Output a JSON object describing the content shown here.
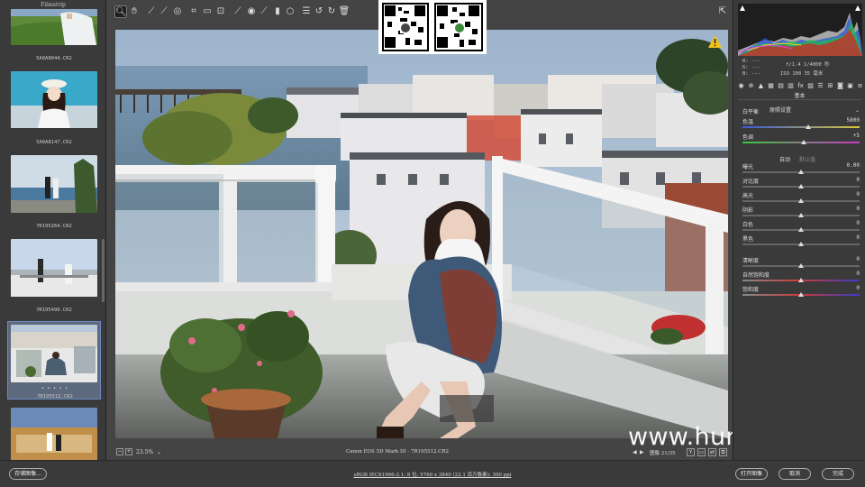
{
  "filmstrip": {
    "title": "Filmstrip",
    "items": [
      {
        "caption": "5A0A8044.CR2",
        "selected": false
      },
      {
        "caption": "5A0A8147.CR2",
        "selected": false
      },
      {
        "caption": "7R195264.CR2",
        "selected": false
      },
      {
        "caption": "7R195490.CR2",
        "selected": false
      },
      {
        "caption": "7R195512.CR2",
        "selected": true,
        "rating": "• • • • •"
      },
      {
        "caption": "",
        "selected": false
      }
    ]
  },
  "toolbar": {
    "tools": [
      "zoom-icon",
      "hand-icon",
      "white-balance-icon",
      "color-sampler-icon",
      "target-adjust-icon",
      "crop-icon",
      "straighten-icon",
      "transform-icon",
      "spot-removal-icon",
      "red-eye-icon",
      "brush-icon",
      "graduated-filter-icon",
      "radial-filter-icon",
      "preferences-icon",
      "rotate-left-icon",
      "rotate-right-icon",
      "trash-icon"
    ],
    "fullscreen": "fullscreen-icon"
  },
  "status": {
    "zoom": "23.5%",
    "camera": "Canon EOS 5D Mark III  -  7R195512.CR2",
    "counter": "图像 21/35",
    "filter_label": "Y"
  },
  "histogram": {
    "r_label": "R:",
    "g_label": "G:",
    "b_label": "B:",
    "r_value": "---",
    "g_value": "---",
    "b_value": "---",
    "exif_line1": "f/1.4  1/4000 秒",
    "exif_line2": "ISO 100  35 毫米"
  },
  "panel": {
    "title": "基本",
    "white_balance_label": "白平衡",
    "white_balance_value": "原照设置",
    "auto_label": "自动",
    "default_label": "默认值",
    "sliders": [
      {
        "name": "temperature",
        "label": "色温",
        "value": "5800",
        "level": 0.56
      },
      {
        "name": "tint",
        "label": "色调",
        "value": "+5",
        "level": 0.52
      },
      {
        "name": "exposure",
        "label": "曝光",
        "value": "0.00",
        "level": 0.5
      },
      {
        "name": "contrast",
        "label": "对比度",
        "value": "0",
        "level": 0.5
      },
      {
        "name": "highlights",
        "label": "高光",
        "value": "0",
        "level": 0.5
      },
      {
        "name": "shadows",
        "label": "阴影",
        "value": "0",
        "level": 0.5
      },
      {
        "name": "whites",
        "label": "白色",
        "value": "0",
        "level": 0.5
      },
      {
        "name": "blacks",
        "label": "黑色",
        "value": "0",
        "level": 0.5
      },
      {
        "name": "clarity",
        "label": "清晰度",
        "value": "0",
        "level": 0.5
      },
      {
        "name": "vibrance",
        "label": "自然饱和度",
        "value": "0",
        "level": 0.5
      },
      {
        "name": "saturation",
        "label": "饱和度",
        "value": "0",
        "level": 0.5
      }
    ]
  },
  "bottom": {
    "save_label": "存储图像...",
    "workflow": "sRGB IEC61966-2.1; 8 位; 5760 x 3840 (22.1 百万像素); 300 ppi",
    "open_label": "打开图像",
    "cancel_label": "取消",
    "done_label": "完成"
  },
  "watermark": "www.hunls.com",
  "colors": {
    "accent": "#6d88c6",
    "panel_bg": "#3a3a3a",
    "warning": "#f2c21b"
  }
}
